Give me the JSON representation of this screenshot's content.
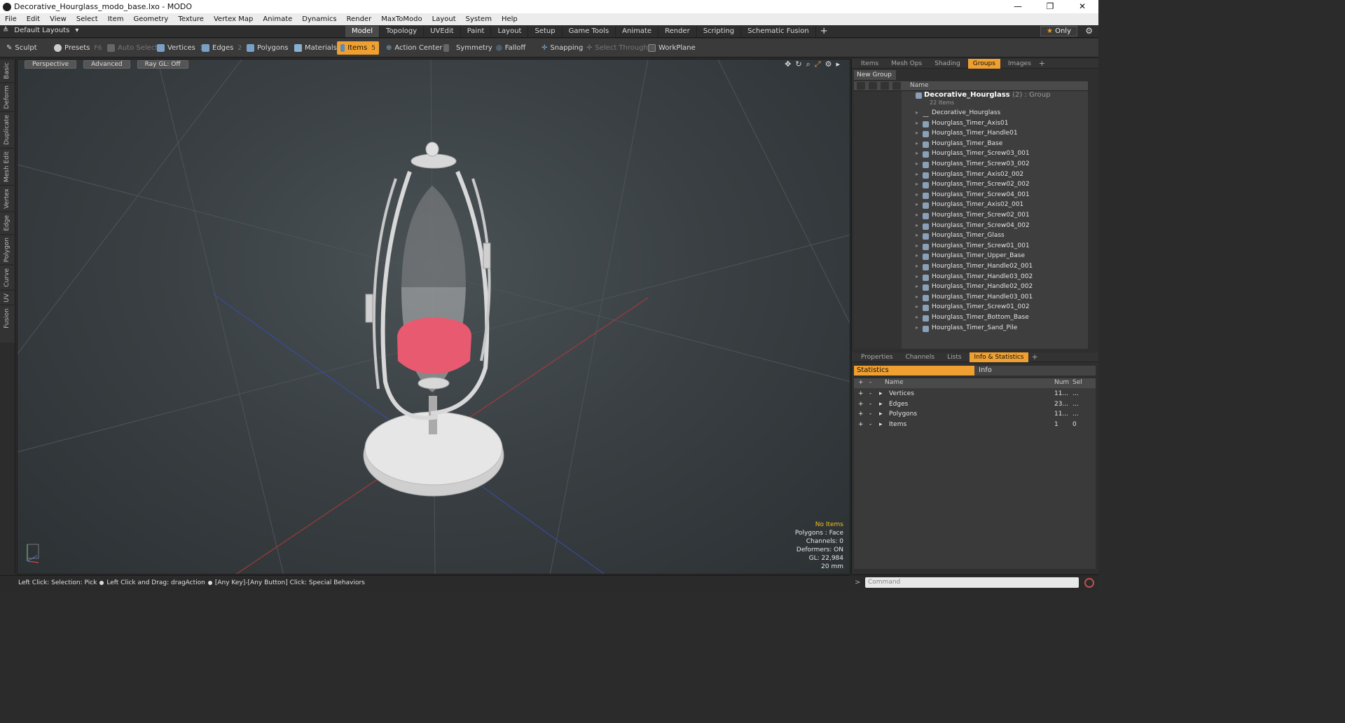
{
  "window": {
    "title": "Decorative_Hourglass_modo_base.lxo - MODO",
    "controls": [
      "—",
      "❐",
      "✕"
    ]
  },
  "menu": [
    "File",
    "Edit",
    "View",
    "Select",
    "Item",
    "Geometry",
    "Texture",
    "Vertex Map",
    "Animate",
    "Dynamics",
    "Render",
    "MaxToModo",
    "Layout",
    "System",
    "Help"
  ],
  "layouts": {
    "label": "Default Layouts"
  },
  "tabs": [
    "Model",
    "Topology",
    "UVEdit",
    "Paint",
    "Layout",
    "Setup",
    "Game Tools",
    "Animate",
    "Render",
    "Scripting",
    "Schematic Fusion"
  ],
  "active_tab": "Model",
  "only_label": "Only",
  "toolbar": {
    "sculpt": "Sculpt",
    "presets": "Presets",
    "presets_key": "F6",
    "auto_select": "Auto Select",
    "vertices": "Vertices",
    "vertices_num": "1",
    "edges": "Edges",
    "edges_num": "2",
    "polygons": "Polygons",
    "materials": "Materials",
    "items": "Items",
    "items_num": "5",
    "action_center": "Action Center",
    "symmetry": "Symmetry",
    "falloff": "Falloff",
    "snapping": "Snapping",
    "select_through": "Select Through",
    "workplane": "WorkPlane"
  },
  "side_tabs": [
    "Basic",
    "Deform",
    "Duplicate",
    "Mesh Edit",
    "Vertex",
    "Edge",
    "Polygon",
    "Curve",
    "UV",
    "Fusion"
  ],
  "viewport": {
    "view": "Perspective",
    "shading": "Advanced",
    "raygl": "Ray GL: Off",
    "info": {
      "selection": "No Items",
      "polygons": "Polygons : Face",
      "channels": "Channels: 0",
      "deformers": "Deformers: ON",
      "gl": "GL: 22,984",
      "scale": "20 mm"
    }
  },
  "status": {
    "left_click": "Left Click: Selection: Pick",
    "drag": "Left Click and Drag: dragAction",
    "special": "[Any Key]-[Any Button] Click: Special Behaviors"
  },
  "groups_panel": {
    "tabs": [
      "Items",
      "Mesh Ops",
      "Shading",
      "Groups",
      "Images"
    ],
    "active": "Groups",
    "new_group": "New Group",
    "col_name": "Name",
    "group": {
      "name": "Decorative_Hourglass",
      "suffix": "(2) : Group",
      "count": "22 Items"
    },
    "items": [
      "Decorative_Hourglass",
      "Hourglass_Timer_Axis01",
      "Hourglass_Timer_Handle01",
      "Hourglass_Timer_Base",
      "Hourglass_Timer_Screw03_001",
      "Hourglass_Timer_Screw03_002",
      "Hourglass_Timer_Axis02_002",
      "Hourglass_Timer_Screw02_002",
      "Hourglass_Timer_Screw04_001",
      "Hourglass_Timer_Axis02_001",
      "Hourglass_Timer_Screw02_001",
      "Hourglass_Timer_Screw04_002",
      "Hourglass_Timer_Glass",
      "Hourglass_Timer_Screw01_001",
      "Hourglass_Timer_Upper_Base",
      "Hourglass_Timer_Handle02_001",
      "Hourglass_Timer_Handle03_002",
      "Hourglass_Timer_Handle02_002",
      "Hourglass_Timer_Handle03_001",
      "Hourglass_Timer_Screw01_002",
      "Hourglass_Timer_Bottom_Base",
      "Hourglass_Timer_Sand_Pile"
    ]
  },
  "stats_panel": {
    "tabs": [
      "Properties",
      "Channels",
      "Lists",
      "Info & Statistics"
    ],
    "active": "Info & Statistics",
    "sub_tabs": [
      "Statistics",
      "Info"
    ],
    "columns": [
      "Name",
      "Num",
      "Sel"
    ],
    "rows": [
      {
        "name": "Vertices",
        "num": "11...",
        "sel": "..."
      },
      {
        "name": "Edges",
        "num": "23...",
        "sel": "..."
      },
      {
        "name": "Polygons",
        "num": "11...",
        "sel": "..."
      },
      {
        "name": "Items",
        "num": "1",
        "sel": "0"
      }
    ]
  },
  "command": {
    "placeholder": "Command"
  },
  "colors": {
    "accent": "#f0a030",
    "sand": "#f06070"
  }
}
